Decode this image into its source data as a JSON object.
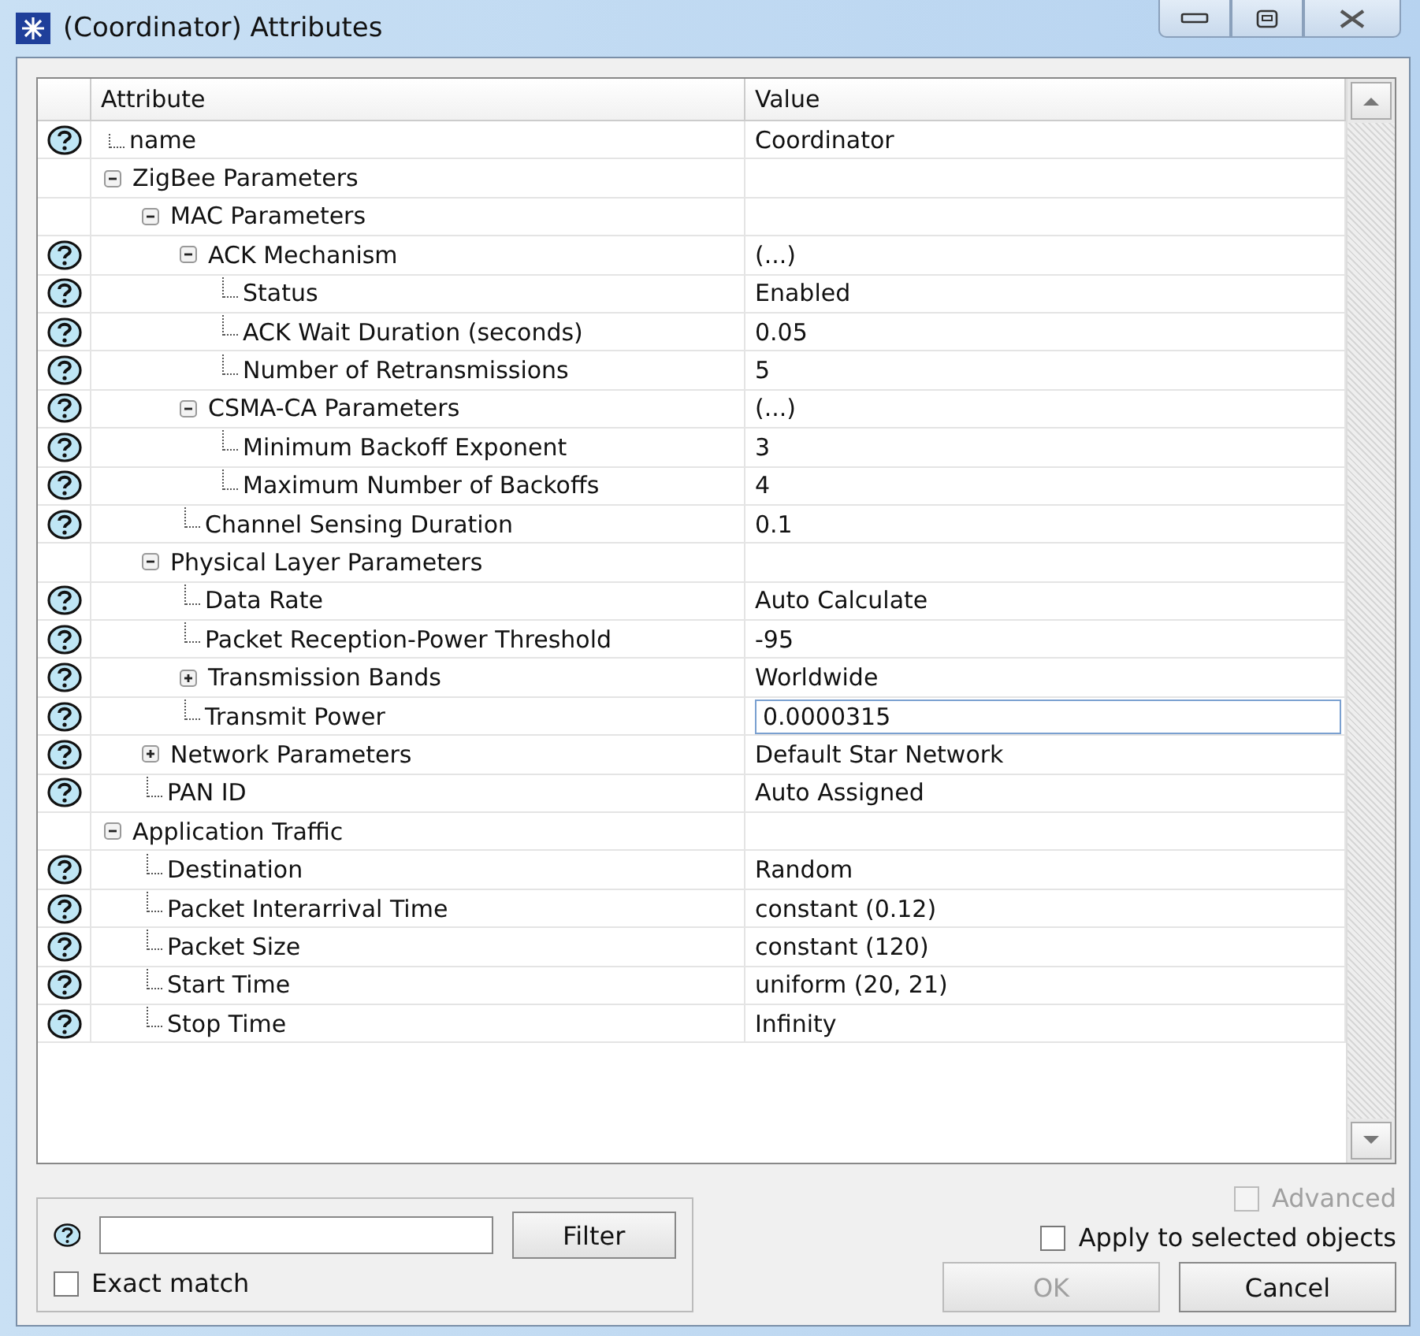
{
  "window": {
    "title": "(Coordinator) Attributes"
  },
  "table": {
    "columns": [
      "Attribute",
      "Value"
    ],
    "rows": [
      {
        "name": "name",
        "value": "Coordinator",
        "help": true
      },
      {
        "name": "ZigBee Parameters",
        "help": false,
        "expanded": true,
        "children": [
          {
            "name": "MAC Parameters",
            "help": false,
            "expanded": true,
            "children": [
              {
                "name": "ACK Mechanism",
                "value": "(...)",
                "help": true,
                "expanded": true,
                "children": [
                  {
                    "name": "Status",
                    "value": "Enabled",
                    "help": true
                  },
                  {
                    "name": "ACK Wait Duration (seconds)",
                    "value": "0.05",
                    "help": true
                  },
                  {
                    "name": "Number of Retransmissions",
                    "value": "5",
                    "help": true
                  }
                ]
              },
              {
                "name": "CSMA-CA Parameters",
                "value": "(...)",
                "help": true,
                "expanded": true,
                "children": [
                  {
                    "name": "Minimum Backoff Exponent",
                    "value": "3",
                    "help": true
                  },
                  {
                    "name": "Maximum Number of Backoffs",
                    "value": "4",
                    "help": true
                  }
                ]
              },
              {
                "name": "Channel Sensing Duration",
                "value": "0.1",
                "help": true
              }
            ]
          },
          {
            "name": "Physical Layer Parameters",
            "help": false,
            "expanded": true,
            "children": [
              {
                "name": "Data Rate",
                "value": "Auto Calculate",
                "help": true
              },
              {
                "name": "Packet Reception-Power Threshold",
                "value": "-95",
                "help": true
              },
              {
                "name": "Transmission Bands",
                "value": "Worldwide",
                "help": true,
                "expanded": false
              },
              {
                "name": "Transmit Power",
                "value": "0.0000315",
                "help": true,
                "editing": true
              }
            ]
          },
          {
            "name": "Network Parameters",
            "value": "Default Star Network",
            "help": true,
            "expanded": false
          },
          {
            "name": "PAN ID",
            "value": "Auto Assigned",
            "help": true
          }
        ]
      },
      {
        "name": "Application Traffic",
        "help": false,
        "expanded": true,
        "children": [
          {
            "name": "Destination",
            "value": "Random",
            "help": true
          },
          {
            "name": "Packet Interarrival Time",
            "value": "constant (0.12)",
            "help": true
          },
          {
            "name": "Packet Size",
            "value": "constant (120)",
            "help": true
          },
          {
            "name": "Start Time",
            "value": "uniform (20, 21)",
            "help": true
          },
          {
            "name": "Stop Time",
            "value": "Infinity",
            "help": true
          }
        ]
      }
    ]
  },
  "filter": {
    "button": "Filter",
    "exact_match": {
      "label": "Exact match",
      "checked": false
    }
  },
  "advanced": {
    "label": "Advanced",
    "checked": false,
    "disabled": true
  },
  "apply_to_selected": {
    "label": "Apply to selected objects",
    "checked": false,
    "disabled": false
  },
  "buttons": [
    {
      "label": "OK",
      "disabled": true
    },
    {
      "label": "Cancel",
      "disabled": false
    }
  ]
}
